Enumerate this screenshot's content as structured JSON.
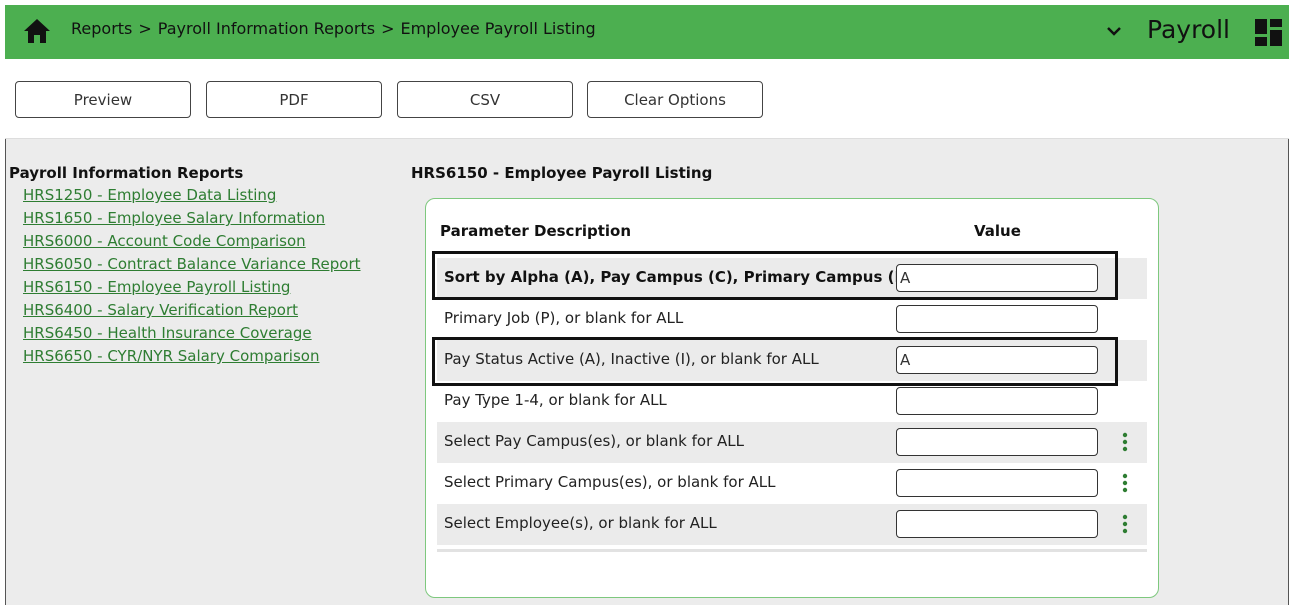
{
  "header": {
    "breadcrumb": [
      "Reports",
      "Payroll Information Reports",
      "Employee Payroll Listing"
    ],
    "separator": ">",
    "app_title": "Payroll",
    "background_color": "#4caf50"
  },
  "toolbar": {
    "preview_label": "Preview",
    "pdf_label": "PDF",
    "csv_label": "CSV",
    "clear_label": "Clear Options"
  },
  "left_panel": {
    "title": "Payroll Information Reports",
    "links": [
      "HRS1250 - Employee Data Listing",
      "HRS1650 - Employee Salary Information",
      "HRS6000 - Account Code Comparison",
      "HRS6050 - Contract Balance Variance Report",
      "HRS6150 - Employee Payroll Listing",
      "HRS6400 - Salary Verification Report",
      "HRS6450 - Health Insurance Coverage",
      "HRS6650 - CYR/NYR Salary Comparison"
    ],
    "link_color": "#2e7d32"
  },
  "report": {
    "title": "HRS6150 - Employee Payroll Listing",
    "col_param": "Parameter Description",
    "col_value": "Value",
    "params": [
      {
        "label": "Sort by Alpha (A), Pay Campus (C), Primary Campus (P)",
        "value": "A",
        "bold": true
      },
      {
        "label": "Primary Job (P), or blank for ALL",
        "value": ""
      },
      {
        "label": "Pay Status Active (A), Inactive (I), or blank for ALL",
        "value": "A"
      },
      {
        "label": "Pay Type 1-4, or blank for ALL",
        "value": ""
      },
      {
        "label": "Select Pay Campus(es), or blank for ALL",
        "value": ""
      },
      {
        "label": "Select Primary Campus(es), or blank for ALL",
        "value": ""
      },
      {
        "label": "Select Employee(s), or blank for ALL",
        "value": ""
      }
    ]
  }
}
